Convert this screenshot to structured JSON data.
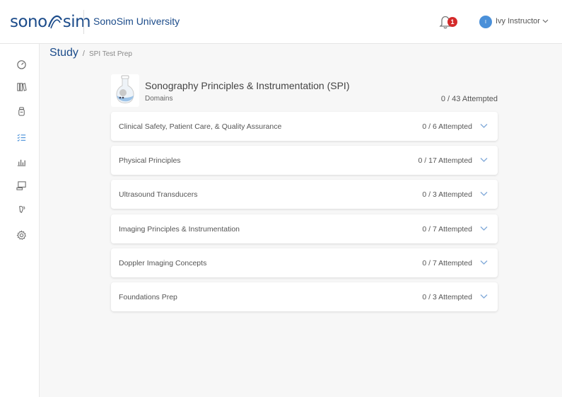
{
  "header": {
    "logo_left": "sono",
    "logo_right": "sim",
    "university": "SonoSim University",
    "notification_count": "1",
    "avatar_initial": "I",
    "user_name": "Ivy Instructor"
  },
  "sidebar": {
    "icons": [
      "dashboard-icon",
      "library-icon",
      "bottle-icon",
      "checklist-icon",
      "chart-icon",
      "monitor-icon",
      "probe-icon",
      "gear-icon"
    ]
  },
  "breadcrumb": {
    "title": "Study",
    "separator": "/",
    "current": "SPI Test Prep"
  },
  "course": {
    "title": "Sonography Principles & Instrumentation (SPI)",
    "subtitle": "Domains",
    "attempted": "0 / 43 Attempted"
  },
  "domains": [
    {
      "name": "Clinical Safety, Patient Care, & Quality Assurance",
      "attempted": "0 / 6 Attempted"
    },
    {
      "name": "Physical Principles",
      "attempted": "0 / 17 Attempted"
    },
    {
      "name": "Ultrasound Transducers",
      "attempted": "0 / 3 Attempted"
    },
    {
      "name": "Imaging Principles & Instrumentation",
      "attempted": "0 / 7 Attempted"
    },
    {
      "name": "Doppler Imaging Concepts",
      "attempted": "0 / 7 Attempted"
    },
    {
      "name": "Foundations Prep",
      "attempted": "0 / 3 Attempted"
    }
  ],
  "colors": {
    "brand": "#1b4b8a",
    "accent": "#4a90d9",
    "badge": "#d42a2a"
  }
}
